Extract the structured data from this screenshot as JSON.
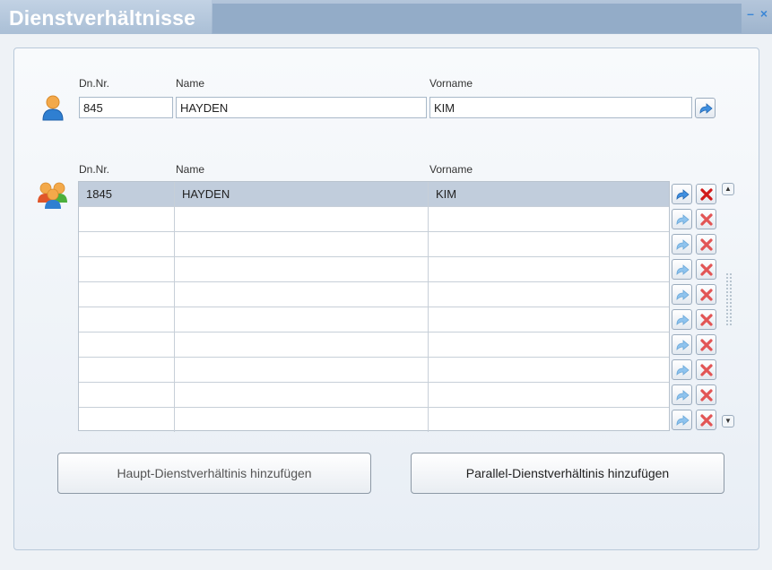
{
  "window": {
    "title": "Dienstverhältnisse",
    "minimize": "–",
    "close": "×"
  },
  "person": {
    "labels": {
      "dnnr": "Dn.Nr.",
      "name": "Name",
      "vorname": "Vorname"
    },
    "values": {
      "dnnr": "845",
      "name": "HAYDEN",
      "vorname": "KIM"
    }
  },
  "relations": {
    "labels": {
      "dnnr": "Dn.Nr.",
      "name": "Name",
      "vorname": "Vorname"
    },
    "rows": [
      {
        "dnnr": "1845",
        "name": "HAYDEN",
        "vorname": "KIM"
      },
      {
        "dnnr": "",
        "name": "",
        "vorname": ""
      },
      {
        "dnnr": "",
        "name": "",
        "vorname": ""
      },
      {
        "dnnr": "",
        "name": "",
        "vorname": ""
      },
      {
        "dnnr": "",
        "name": "",
        "vorname": ""
      },
      {
        "dnnr": "",
        "name": "",
        "vorname": ""
      },
      {
        "dnnr": "",
        "name": "",
        "vorname": ""
      },
      {
        "dnnr": "",
        "name": "",
        "vorname": ""
      },
      {
        "dnnr": "",
        "name": "",
        "vorname": ""
      },
      {
        "dnnr": "",
        "name": "",
        "vorname": ""
      }
    ]
  },
  "buttons": {
    "haupt": "Haupt-Dienstverhältinis hinzufügen",
    "parallel": "Parallel-Dienstverhältinis hinzufügen"
  },
  "icons": {
    "person": "person-icon",
    "group": "group-icon",
    "open": "arrow-right-icon",
    "delete": "delete-x-icon"
  }
}
